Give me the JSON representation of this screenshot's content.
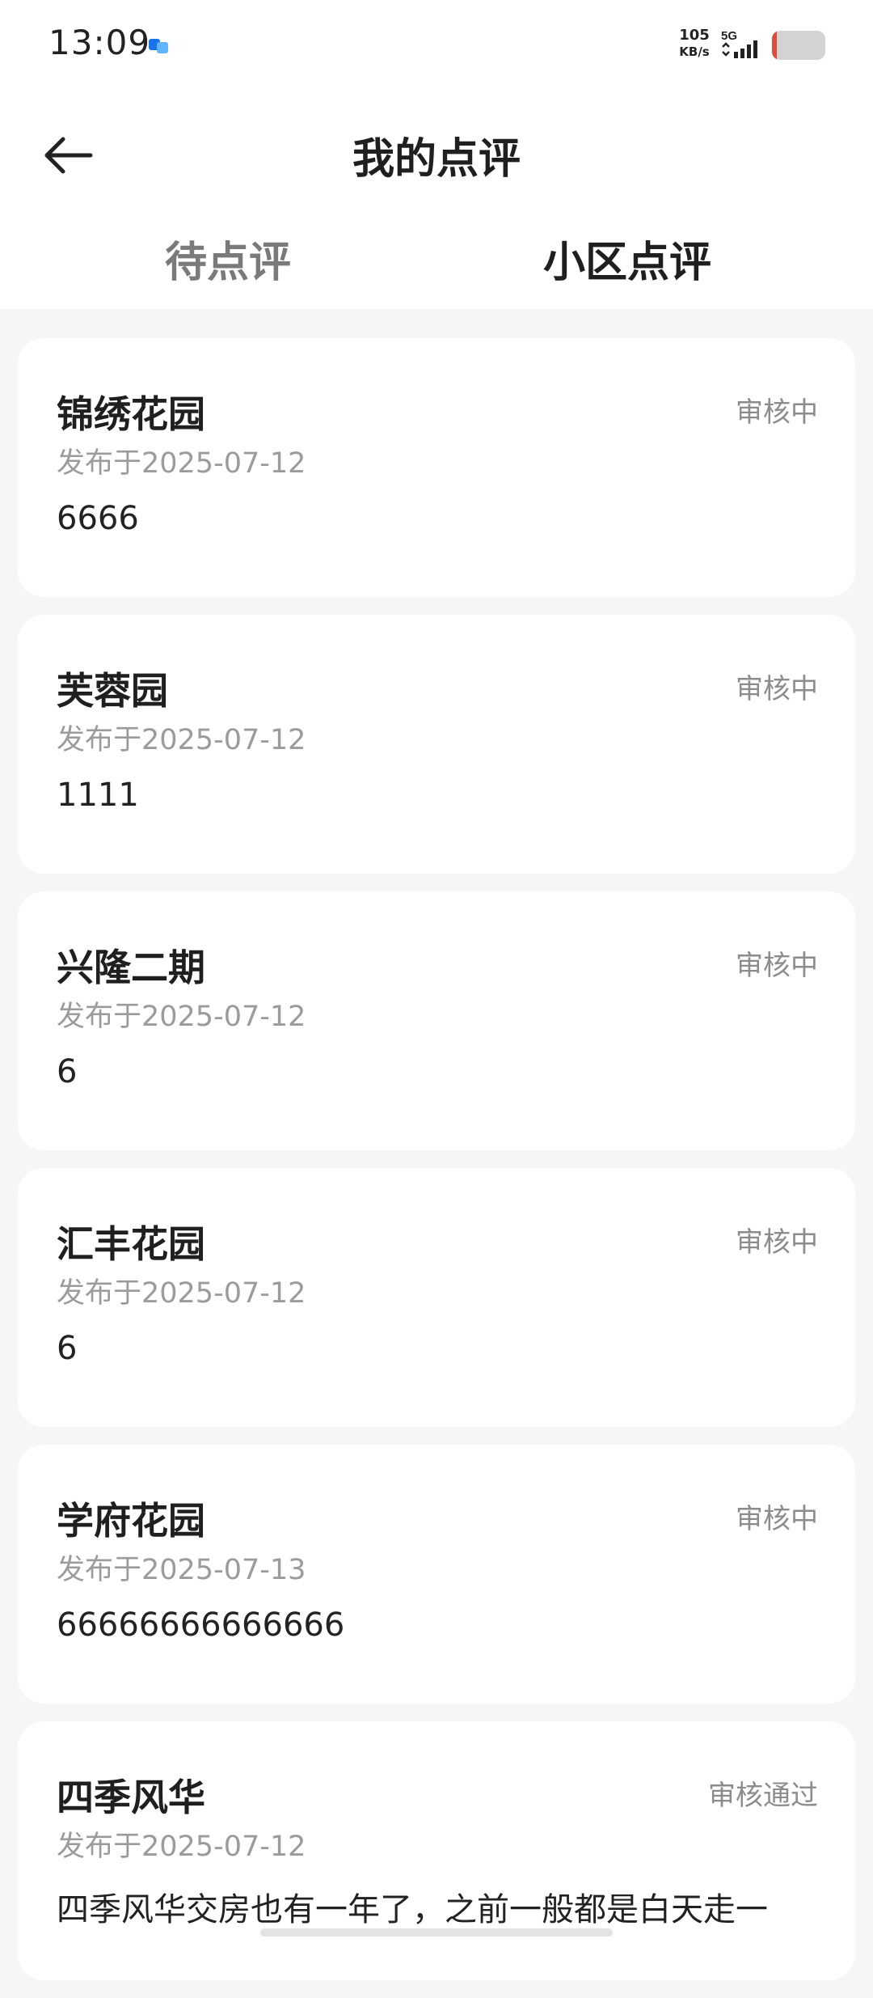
{
  "status_bar": {
    "time": "13:09",
    "net_speed_value": "105",
    "net_speed_unit": "KB/s",
    "network_type": "5G",
    "battery_icon": "battery-low-icon"
  },
  "header": {
    "back_icon": "back-arrow-icon",
    "title": "我的点评"
  },
  "tabs": [
    {
      "label": "待点评",
      "active": false
    },
    {
      "label": "小区点评",
      "active": true
    }
  ],
  "reviews": [
    {
      "community": "锦绣花园",
      "status": "审核中",
      "date": "发布于2025-07-12",
      "content": "6666"
    },
    {
      "community": "芙蓉园",
      "status": "审核中",
      "date": "发布于2025-07-12",
      "content": "1111"
    },
    {
      "community": "兴隆二期",
      "status": "审核中",
      "date": "发布于2025-07-12",
      "content": "6"
    },
    {
      "community": "汇丰花园",
      "status": "审核中",
      "date": "发布于2025-07-12",
      "content": "6"
    },
    {
      "community": "学府花园",
      "status": "审核中",
      "date": "发布于2025-07-13",
      "content": "66666666666666"
    },
    {
      "community": "四季风华",
      "status": "审核通过",
      "date": "发布于2025-07-12",
      "content": "四季风华交房也有一年了，之前一般都是白天走一"
    }
  ],
  "colors": {
    "accent": "#4a7ceb",
    "battery_low": "#e04b3c",
    "background": "#f6f6f6"
  }
}
